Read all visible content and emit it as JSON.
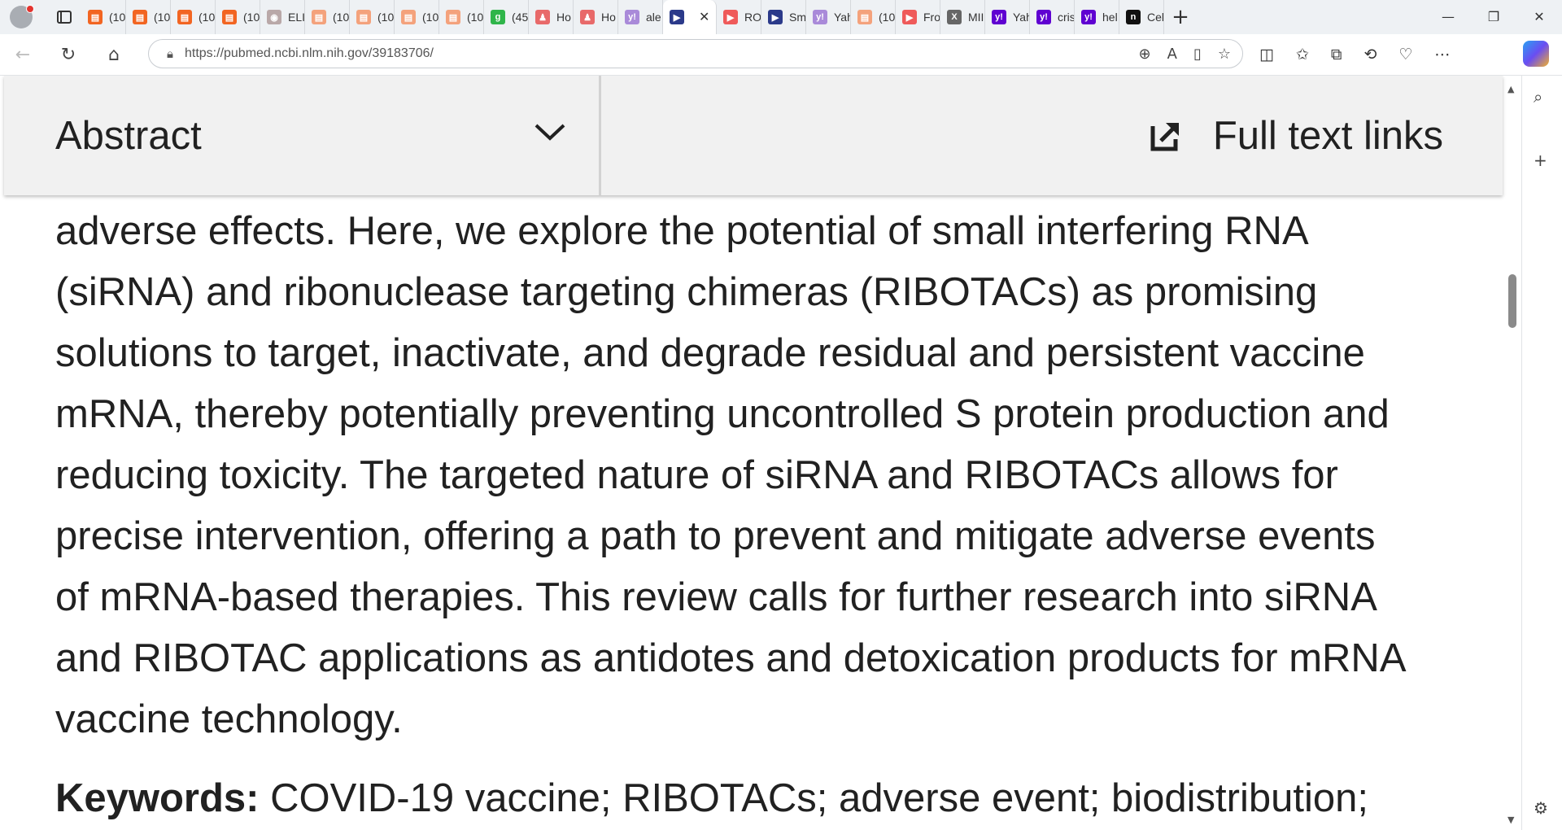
{
  "browser": {
    "tabs": [
      {
        "label": "(10",
        "color": "#f26522",
        "glyph": "▤"
      },
      {
        "label": "(10",
        "color": "#f26522",
        "glyph": "▤"
      },
      {
        "label": "(10",
        "color": "#f26522",
        "glyph": "▤"
      },
      {
        "label": "(10",
        "color": "#f26522",
        "glyph": "▤"
      },
      {
        "label": "ELII",
        "color": "#b9a8a8",
        "glyph": "◉"
      },
      {
        "label": "(10",
        "color": "#f4a27c",
        "glyph": "▤"
      },
      {
        "label": "(10",
        "color": "#f4a27c",
        "glyph": "▤"
      },
      {
        "label": "(10",
        "color": "#f4a27c",
        "glyph": "▤"
      },
      {
        "label": "(10",
        "color": "#f4a27c",
        "glyph": "▤"
      },
      {
        "label": "(45",
        "color": "#2fb54a",
        "glyph": "g"
      },
      {
        "label": "Ho",
        "color": "#e86a6a",
        "glyph": "♟"
      },
      {
        "label": "Ho",
        "color": "#e86a6a",
        "glyph": "♟"
      },
      {
        "label": "ale",
        "color": "#a98ad9",
        "glyph": "y!"
      },
      {
        "label": "",
        "color": "#2b3a8a",
        "glyph": "▶",
        "active": true
      },
      {
        "label": "RO",
        "color": "#ef5a5a",
        "glyph": "▶"
      },
      {
        "label": "Sm",
        "color": "#2b3a8a",
        "glyph": "▶"
      },
      {
        "label": "Yah",
        "color": "#a98ad9",
        "glyph": "y!"
      },
      {
        "label": "(10",
        "color": "#f4a27c",
        "glyph": "▤"
      },
      {
        "label": "Fro",
        "color": "#ef5a5a",
        "glyph": "▶"
      },
      {
        "label": "MII",
        "color": "#666666",
        "glyph": "X"
      },
      {
        "label": "Yah",
        "color": "#5f01d1",
        "glyph": "y!"
      },
      {
        "label": "cris",
        "color": "#5f01d1",
        "glyph": "y!"
      },
      {
        "label": "hel",
        "color": "#5f01d1",
        "glyph": "y!"
      },
      {
        "label": "Cel",
        "color": "#111111",
        "glyph": "n"
      }
    ],
    "url": "https://pubmed.ncbi.nlm.nih.gov/39183706/"
  },
  "page": {
    "abstract_tab": "Abstract",
    "full_text_links": "Full text links",
    "lines": [
      "adverse effects. Here, we explore the potential of small interfering RNA",
      "(siRNA) and ribonuclease targeting chimeras (RIBOTACs) as promising",
      "solutions to target, inactivate, and degrade residual and persistent vaccine",
      "mRNA, thereby potentially preventing uncontrolled S protein production and",
      "reducing toxicity. The targeted nature of siRNA and RIBOTACs allows for",
      "precise intervention, offering a path to prevent and mitigate adverse events",
      "of mRNA-based therapies. This review calls for further research into siRNA",
      "and RIBOTAC applications as antidotes and detoxication products for mRNA",
      "vaccine technology."
    ],
    "keywords_label": "Keywords:",
    "keywords_text": " COVID-19 vaccine; RIBOTACs; adverse event; biodistribution;"
  }
}
